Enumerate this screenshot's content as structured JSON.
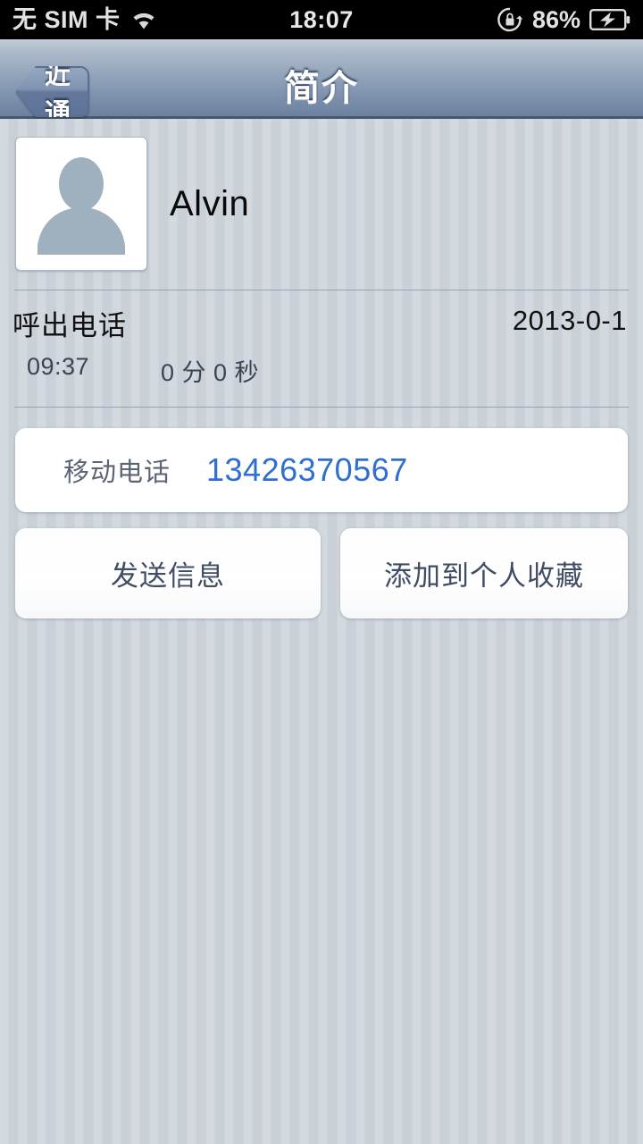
{
  "status_bar": {
    "carrier": "无 SIM 卡",
    "wifi_icon": "wifi-icon",
    "time": "18:07",
    "rotation_lock_icon": "rotation-lock-icon",
    "battery_percent": "86%",
    "battery_icon": "battery-charging-icon"
  },
  "nav_bar": {
    "back_label": "最近通话",
    "title": "简介",
    "back_chevron_icon": "chevron-left-icon"
  },
  "profile": {
    "avatar_icon": "person-placeholder-icon",
    "name": "Alvin"
  },
  "call_record": {
    "type": "呼出电话",
    "date": "2013-0-1",
    "time": "09:37",
    "duration": "0 分 0 秒"
  },
  "phone_entry": {
    "label": "移动电话",
    "number": "13426370567"
  },
  "actions": {
    "send_message": "发送信息",
    "add_favorite": "添加到个人收藏"
  },
  "colors": {
    "accent_blue": "#2f6fd2",
    "nav_bottom": "#6c82a0",
    "label_slate": "#5c6575",
    "button_text": "#3f4c64",
    "background": "#ced4db"
  }
}
